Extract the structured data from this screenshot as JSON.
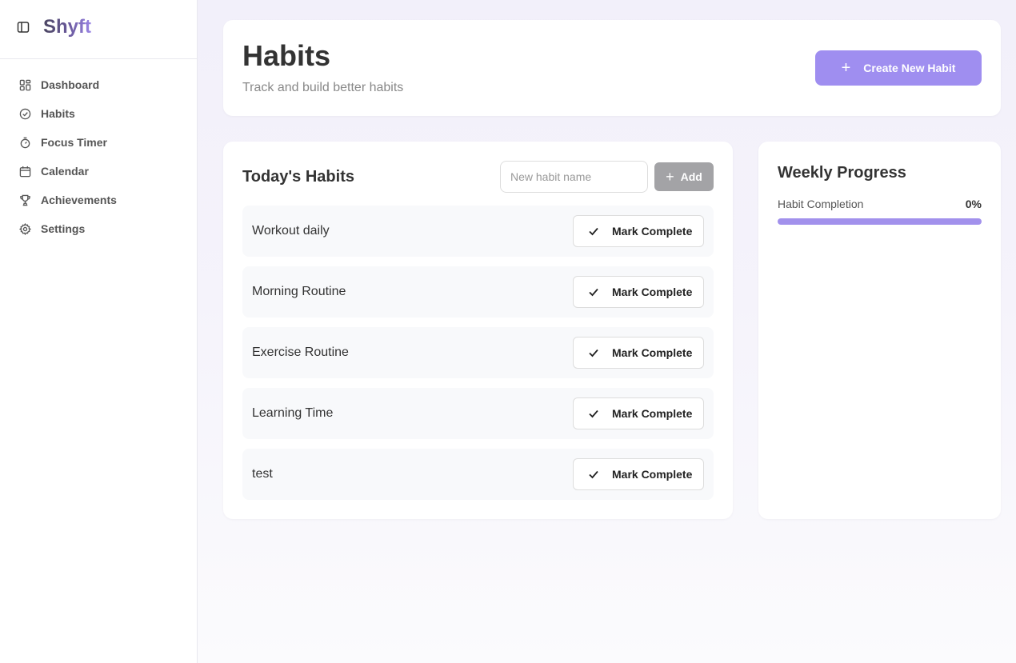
{
  "app": {
    "name": "Shyft"
  },
  "sidebar": {
    "items": [
      {
        "label": "Dashboard",
        "icon": "dashboard-icon"
      },
      {
        "label": "Habits",
        "icon": "check-circle-icon"
      },
      {
        "label": "Focus Timer",
        "icon": "timer-icon"
      },
      {
        "label": "Calendar",
        "icon": "calendar-icon"
      },
      {
        "label": "Achievements",
        "icon": "trophy-icon"
      },
      {
        "label": "Settings",
        "icon": "gear-icon"
      }
    ]
  },
  "header": {
    "title": "Habits",
    "subtitle": "Track and build better habits",
    "create_label": "Create New Habit"
  },
  "habits": {
    "title": "Today's Habits",
    "input_placeholder": "New habit name",
    "input_value": "",
    "add_label": "Add",
    "mark_label": "Mark Complete",
    "items": [
      {
        "name": "Workout daily"
      },
      {
        "name": "Morning Routine"
      },
      {
        "name": "Exercise Routine"
      },
      {
        "name": "Learning Time"
      },
      {
        "name": "test"
      }
    ]
  },
  "weekly": {
    "title": "Weekly Progress",
    "label": "Habit Completion",
    "value_text": "0%",
    "value": 0
  },
  "colors": {
    "accent": "#9f8ef0",
    "progress_track": "#a291ec",
    "add_button": "#a3a3a6"
  }
}
